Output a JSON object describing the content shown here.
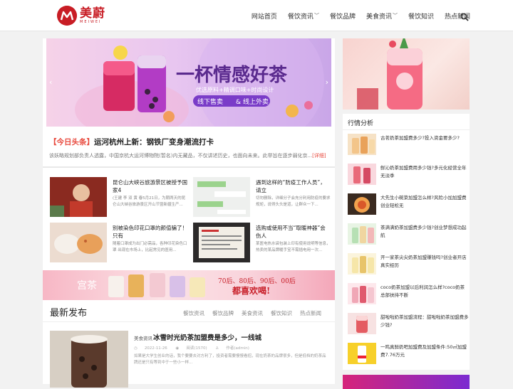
{
  "brand": {
    "name_cn": "美蔚",
    "name_en": "MEIWEI",
    "color": "#c81d25"
  },
  "nav": {
    "items": [
      {
        "label": "网站首页",
        "dropdown": false
      },
      {
        "label": "餐饮资讯",
        "dropdown": true
      },
      {
        "label": "餐饮品牌",
        "dropdown": false
      },
      {
        "label": "美食资讯",
        "dropdown": true
      },
      {
        "label": "餐饮知识",
        "dropdown": false
      },
      {
        "label": "热点新闻",
        "dropdown": false
      }
    ],
    "search_icon": "search-icon"
  },
  "banner": {
    "headline_art": "一杯情感好茶",
    "sub": "优选原料+精调口味+时尚设计",
    "pill1": "线下售卖",
    "pill2": "线上外卖"
  },
  "headline": {
    "tag": "【今日头条】",
    "title": "运河杭州上新：钢铁厂变身潮流打卡",
    "excerpt": "该妖略规划部负责人透露，中国京杭大运河博物院(暂名)内无藏品，不仅讲述历史，也面向未来。此举旨在逐步弱化京...",
    "more": "[详细]"
  },
  "grid": [
    {
      "title": "昆仑山大峡谷旅游景区被授予国家4",
      "desc": "(王建 李 双 黄 春5月21日，为期两天的昆仑山大峡谷旅游景区开山节暨新疆生产..."
    },
    {
      "title": "遇到这样的“防疫工作人员”，请立",
      "desc": "切勿删除，详细分子会充分利用防疫的要求规矩，说得头头是道，让群众一下..."
    },
    {
      "title": "别被染色印花口罩的颜值骗了！只有",
      "desc": "随着口罩成为出门必需品，各种印花染色口罩 出现在市场上，比起常见的医用..."
    },
    {
      "title": "选购或使用不当“取暖神器”会伤人",
      "desc": "某医电热水袋包装上印有使用说明等信息，热卖的某品牌暖手宝不需插电用一次..."
    }
  ],
  "ad_strip": {
    "brand": "宫茶",
    "line1": "70后、80后、90后、00后",
    "line2": "都喜欢喝!"
  },
  "latest": {
    "heading": "最新发布",
    "tabs": [
      "餐饮资讯",
      "餐饮品牌",
      "美食资讯",
      "餐饮知识",
      "热点新闻"
    ],
    "post": {
      "category": "美食资讯",
      "title": "冰雪时光奶茶加盟费是多少，一线城",
      "date": "2022-11-26",
      "views": "阅读(1570)",
      "author": "作者(admin)",
      "desc": "如果是大学生创业的话，我个要要去对方利了，投资者需要慢慢看招，现在奶茶的品牌很多，但是低档的奶茶品牌还是只有等到中于一些小一样..."
    }
  },
  "sidebar": {
    "title": "行情分析",
    "items": [
      "古茗奶茶加盟费多少?投入资金要多少?",
      "鲜沁奶茶加盟费用多少钱?多元化经营全年无淡季",
      "大先生小碗菜加盟怎么样?风险小加加盟费创业轻松无",
      "茶满满奶茶加盟费多少钱?创业梦想成功起航",
      "开一家茶尖尖奶茶加盟赚钱吗?创业者开店真实经历",
      "coco奶茶加盟以后利润怎么样?coco奶茶总部扶持不断",
      "甜啦啦奶茶加盟流程：甜啦啦奶茶加盟费多少钱?",
      "一鸣真鲜奶吧加盟费及加盟条件:50㎡加盟费7.76万元"
    ]
  },
  "colors": {
    "accent": "#e8493d",
    "side_item_thumb": [
      "#f3c58a",
      "#e96a7a",
      "#f1a24d",
      "#b7e0b4",
      "#f6e6a8",
      "#f0a7b6",
      "#e45c62",
      "#f7d02a"
    ]
  }
}
